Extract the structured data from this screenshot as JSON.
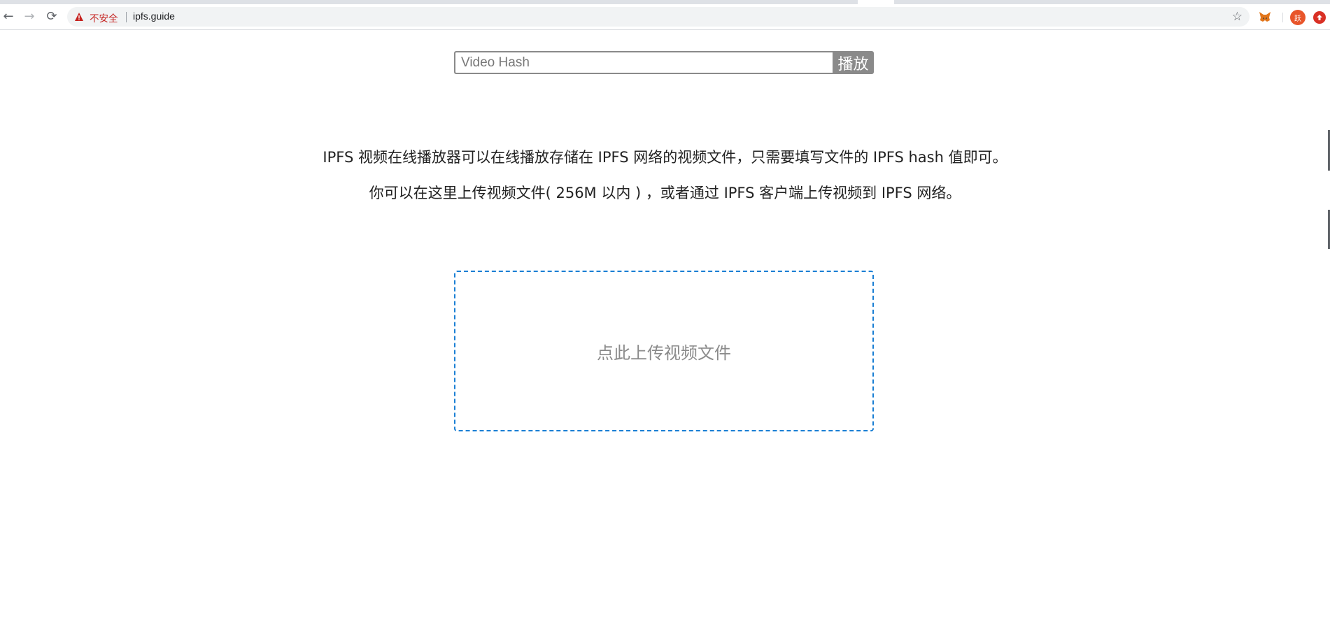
{
  "browser": {
    "security_label": "不安全",
    "url": "ipfs.guide",
    "avatar_initial": "跃",
    "nav": {
      "back_icon": "←",
      "forward_icon": "→",
      "reload_icon": "⟳",
      "bookmark_icon": "☆"
    }
  },
  "hash_search": {
    "placeholder": "Video Hash",
    "value": "",
    "play_label": "播放"
  },
  "description": {
    "line1": "IPFS 视频在线播放器可以在线播放存储在 IPFS 网络的视频文件，只需要填写文件的 IPFS hash 值即可。",
    "line2": "你可以在这里上传视频文件( 256M 以内 ) ，或者通过 IPFS 客户端上传视频到 IPFS 网络。"
  },
  "upload": {
    "label": "点此上传视频文件"
  },
  "colors": {
    "upload_border": "#1a7fd4",
    "button_bg": "#8a8a8a",
    "warning": "#c5221f"
  }
}
